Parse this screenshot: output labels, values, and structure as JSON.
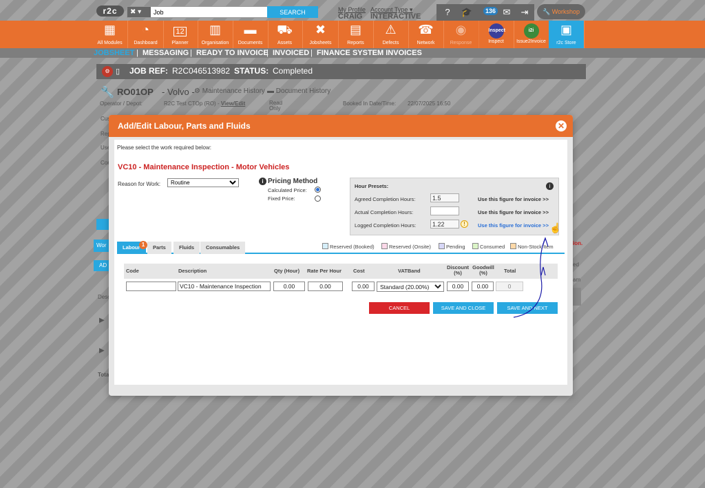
{
  "topbar": {
    "logo": "r2c",
    "search_value": "Job",
    "search_button": "SEARCH",
    "profile_link": "My Profile",
    "profile_name": "CRAIG",
    "account_type_link": "Account Type",
    "account_type_value": "INTERACTIVE",
    "notification_count": "136",
    "workshop_label": "Workshop"
  },
  "modules": [
    {
      "label": "All Modules",
      "icon": "grid-icon"
    },
    {
      "label": "Dashboard",
      "icon": "gauge-icon"
    },
    {
      "label": "Planner",
      "icon": "calendar-icon",
      "day": "12"
    },
    {
      "label": "Organisation",
      "icon": "building-icon"
    },
    {
      "label": "Documents",
      "icon": "folder-icon"
    },
    {
      "label": "Assets",
      "icon": "truck-icon"
    },
    {
      "label": "Jobsheets",
      "icon": "tools-icon"
    },
    {
      "label": "Reports",
      "icon": "clipboard-icon"
    },
    {
      "label": "Defects",
      "icon": "warning-icon"
    },
    {
      "label": "Network",
      "icon": "contacts-icon"
    },
    {
      "label": "Response",
      "icon": "response-icon"
    },
    {
      "label": "Inspect",
      "icon": "inspect-icon",
      "badge": "Inspect"
    },
    {
      "label": "Issue2Invoice",
      "icon": "i2i-icon",
      "badge": "i2i"
    },
    {
      "label": "r2c Store",
      "icon": "store-icon"
    }
  ],
  "subnav": [
    "JOBSHEET",
    "MESSAGING",
    "READY TO INVOICE",
    "INVOICED",
    "FINANCE SYSTEM INVOICES"
  ],
  "job": {
    "ref_label": "JOB REF:",
    "ref_value": "R2C046513982",
    "status_label": "STATUS:",
    "status_value": "Completed",
    "reg": "RO01OP",
    "make": "Volvo",
    "maintenance_history": "Maintenance History",
    "document_history": "Document History",
    "operator_label": "Operator / Depot:",
    "operator_value": "R2C Test CTOp (RO) -",
    "view_edit": "View/Edit",
    "read_only": "Read Only",
    "booked_label": "Booked In Date/Time:",
    "booked_value": "22/07/2025 16:50",
    "stubs": [
      "Cus",
      "Rep",
      "Use",
      "Con",
      "Wor",
      "AD",
      "Desc",
      "Tota",
      "ion.",
      "ed",
      "am"
    ]
  },
  "modal": {
    "title": "Add/Edit Labour, Parts and Fluids",
    "prompt": "Please select the work required below:",
    "work_title": "VC10 - Maintenance Inspection - Motor Vehicles",
    "reason_label": "Reason for Work:",
    "reason_value": "Routine",
    "pricing_title": "Pricing Method",
    "calculated_price": "Calculated Price:",
    "fixed_price": "Fixed Price:",
    "presets": {
      "title": "Hour Presets:",
      "agreed_label": "Agreed Completion Hours:",
      "agreed_value": "1.5",
      "actual_label": "Actual Completion Hours:",
      "actual_value": "",
      "logged_label": "Logged Completion Hours:",
      "logged_value": "1.22",
      "use_figure": "Use this figure for invoice >>"
    },
    "tabs": [
      "Labour",
      "Parts",
      "Fluids",
      "Consumables"
    ],
    "labour_badge": "1",
    "legend": [
      "Reserved (Booked)",
      "Reserved (Onsite)",
      "Pending",
      "Consumed",
      "Non-Stock Item"
    ],
    "legend_colors": [
      "#d6effa",
      "#fbd8e8",
      "#d8d8f8",
      "#dcf5c8",
      "#ffd9a8"
    ],
    "columns": {
      "code": "Code",
      "description": "Description",
      "qty": "Qty (Hour)",
      "rate": "Rate Per Hour",
      "cost": "Cost",
      "vatband": "VATBand",
      "discount": "Discount (%)",
      "goodwill": "Goodwill (%)",
      "total": "Total"
    },
    "row": {
      "code": "",
      "description": "VC10 - Maintenance Inspection",
      "qty": "0.00",
      "rate": "0.00",
      "cost": "0.00",
      "vatband": "Standard (20.00%)",
      "discount": "0.00",
      "goodwill": "0.00",
      "total": "0"
    },
    "buttons": {
      "cancel": "CANCEL",
      "save_close": "SAVE AND CLOSE",
      "save_next": "SAVE AND NEXT"
    }
  },
  "colors": {
    "brand_orange": "#e8702e",
    "accent_blue": "#29a8e0",
    "title_red": "#cc2222",
    "cancel_red": "#d9262a"
  }
}
